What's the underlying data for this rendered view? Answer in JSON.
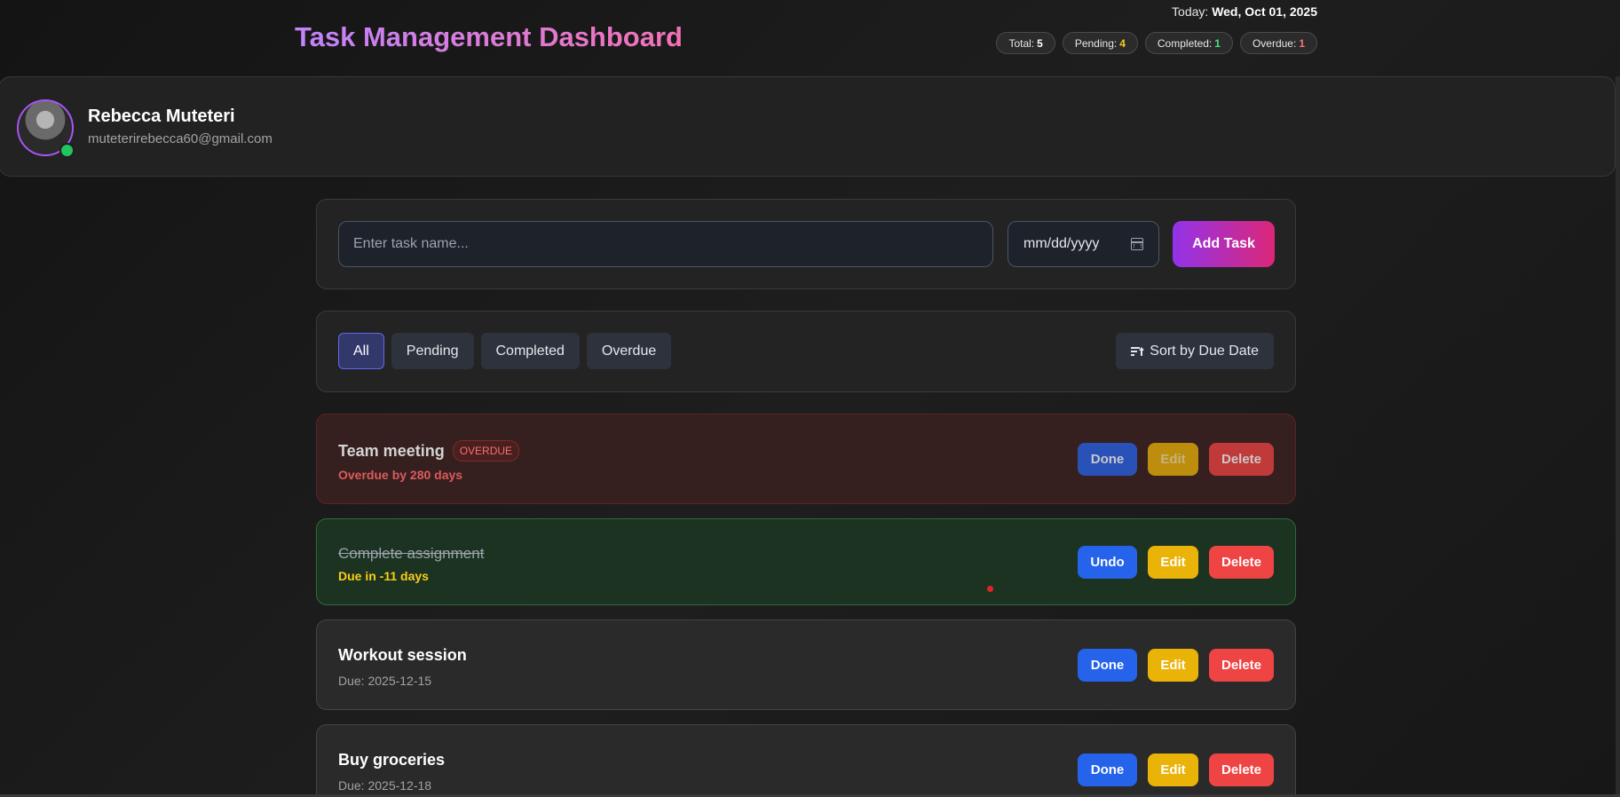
{
  "header": {
    "title": "Task Management Dashboard",
    "today_label": "Today:",
    "today_date": "Wed, Oct 01, 2025",
    "stats": [
      {
        "label": "Total:",
        "value": "5"
      },
      {
        "label": "Pending:",
        "value": "4"
      },
      {
        "label": "Completed:",
        "value": "1"
      },
      {
        "label": "Overdue:",
        "value": "1"
      }
    ]
  },
  "profile": {
    "name": "Rebecca Muteteri",
    "email": "muteterirebecca60@gmail.com",
    "status": "online"
  },
  "add_task": {
    "task_placeholder": "Enter task name...",
    "date_placeholder": "mm/dd/yyyy",
    "add_label": "Add Task"
  },
  "filters": {
    "items": [
      "All",
      "Pending",
      "Completed",
      "Overdue"
    ],
    "active": "All",
    "sort_label": "Sort by Due Date"
  },
  "tasks": [
    {
      "title": "Team meeting",
      "badge": "OVERDUE",
      "subtitle": "Overdue by 280 days",
      "state": "overdue",
      "primary_action": "Done",
      "edit": "Edit",
      "delete": "Delete"
    },
    {
      "title": "Complete assignment",
      "subtitle": "Due in -11 days",
      "state": "completed",
      "primary_action": "Undo",
      "edit": "Edit",
      "delete": "Delete"
    },
    {
      "title": "Workout session",
      "subtitle": "Due: 2025-12-15",
      "state": "pending",
      "primary_action": "Done",
      "edit": "Edit",
      "delete": "Delete"
    },
    {
      "title": "Buy groceries",
      "subtitle": "Due: 2025-12-18",
      "state": "pending",
      "primary_action": "Done",
      "edit": "Edit",
      "delete": "Delete"
    }
  ],
  "colors": {
    "accent_start": "#9333ea",
    "accent_end": "#db2777",
    "done_blue": "#2563eb",
    "edit_yellow": "#eab308",
    "delete_red": "#ef4444",
    "online_green": "#22c55e"
  }
}
